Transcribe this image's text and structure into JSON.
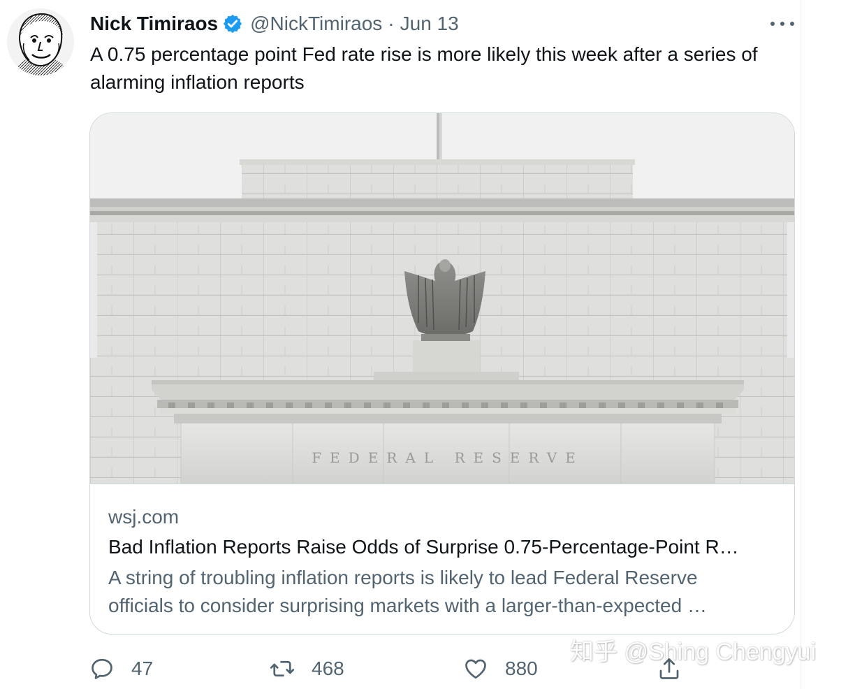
{
  "tweet": {
    "author_name": "Nick Timiraos",
    "handle": "@NickTimiraos",
    "separator": "·",
    "date": "Jun 13",
    "text": "A 0.75 percentage point Fed rate rise is more likely this week after a series of alarming inflation reports",
    "verified_icon": "verified-badge-icon",
    "more_icon": "more-options-icon"
  },
  "card": {
    "image_caption": "FEDERAL RESERVE",
    "domain": "wsj.com",
    "title": "Bad Inflation Reports Raise Odds of Surprise 0.75-Percentage-Point R…",
    "description": "A string of troubling inflation reports is likely to lead Federal Reserve officials to consider surprising markets with a larger-than-expected …"
  },
  "actions": {
    "reply": {
      "icon": "reply-icon",
      "count": "47"
    },
    "retweet": {
      "icon": "retweet-icon",
      "count": "468"
    },
    "like": {
      "icon": "heart-icon",
      "count": "880"
    },
    "share": {
      "icon": "share-icon"
    }
  },
  "watermark": {
    "text": "知乎 @Shing Chengyui"
  },
  "colors": {
    "text_primary": "#0f1419",
    "text_secondary": "#536471",
    "border": "#cfd9de",
    "verified_blue": "#1d9bf0"
  }
}
